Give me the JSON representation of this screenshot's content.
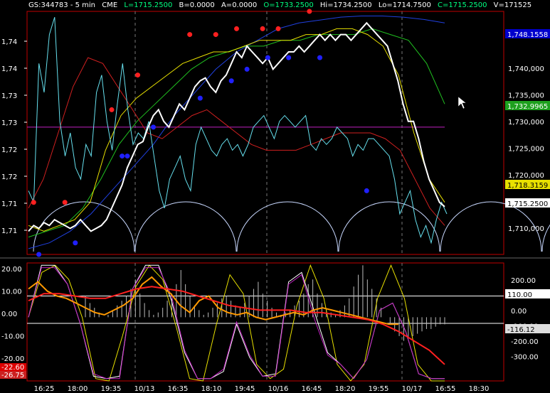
{
  "header": {
    "symbol": "GS:344783 - 5 min",
    "exchange": "CME",
    "last": "L=1715.2500",
    "bid": "B=0.0000",
    "ask": "A=0.0000",
    "open": "O=1733.2500",
    "high": "Hi=1734.2500",
    "low": "Lo=1714.7500",
    "close": "C=1715.2500",
    "volume": "V=171525"
  },
  "colors": {
    "background": "#000000",
    "frame": "#c00000",
    "price": "#ffffff",
    "cyan": "#66e0ee",
    "red_ma": "#d02020",
    "yellow_ma": "#e8e000",
    "green_ma": "#20c020",
    "blue_ma": "#2040e0",
    "magenta": "#c020c0",
    "arcs": "#c8d8ff",
    "dot_red": "#ff2020",
    "dot_blue": "#2020ff",
    "orange": "#ff9900"
  },
  "chart_data": [
    {
      "type": "line",
      "panel": "price",
      "y_ticks_left": [
        "1,74",
        "1,74",
        "1,73",
        "1,73",
        "1,72",
        "1,72",
        "1,71",
        "1,71"
      ],
      "y_ticks_right": [
        "1,740,000",
        "1,735,000",
        "1,730,000",
        "1,725,000",
        "1,720,000",
        "1,715,000",
        "1,710,000"
      ],
      "right_price_tags": [
        {
          "value": "1,748.1558",
          "color": "#0000cc"
        },
        {
          "value": "1,732.9965",
          "color": "#1ea01e"
        },
        {
          "value": "1,718.3159",
          "color": "#e8e000"
        },
        {
          "value": "1,715.2500",
          "color": "#ffffff"
        }
      ],
      "ylim": [
        1707,
        1749
      ],
      "horizontal_line": 1729,
      "price_series": [
        1711,
        1712,
        1711.5,
        1712.5,
        1712,
        1713,
        1712.5,
        1712,
        1711.5,
        1712,
        1713,
        1712,
        1711,
        1711.5,
        1712,
        1713,
        1715,
        1717,
        1719,
        1722,
        1724,
        1726,
        1726.5,
        1729,
        1731,
        1732,
        1730,
        1729,
        1731,
        1733,
        1732,
        1734,
        1736,
        1737,
        1737.5,
        1736,
        1735,
        1737,
        1738,
        1740,
        1742,
        1741,
        1743,
        1742,
        1741,
        1740,
        1741,
        1739,
        1740,
        1741,
        1742,
        1742,
        1743,
        1742,
        1743,
        1744,
        1745,
        1744,
        1745,
        1744,
        1745,
        1745,
        1744,
        1745,
        1746,
        1747,
        1746,
        1745,
        1744,
        1743,
        1740,
        1737,
        1733,
        1730,
        1730,
        1727,
        1723,
        1720,
        1718,
        1716,
        1715.25
      ],
      "cyan_series": [
        1718,
        1716,
        1740,
        1735,
        1745,
        1748,
        1730,
        1724,
        1728,
        1722,
        1720,
        1726,
        1724,
        1735,
        1738,
        1730,
        1725,
        1733,
        1740,
        1732,
        1726,
        1728,
        1727,
        1730,
        1724,
        1718,
        1715,
        1720,
        1722,
        1724,
        1720,
        1718,
        1726,
        1729,
        1727,
        1725,
        1724,
        1726,
        1727,
        1725,
        1726,
        1724,
        1726,
        1729,
        1730,
        1731,
        1729,
        1727,
        1730,
        1731,
        1730,
        1729,
        1730,
        1731,
        1726,
        1725,
        1727,
        1726,
        1727,
        1729,
        1728,
        1727,
        1724,
        1726,
        1725,
        1727,
        1727,
        1726,
        1725,
        1724,
        1720,
        1714,
        1716,
        1718,
        1713,
        1710,
        1712,
        1709,
        1713,
        1716,
        1714
      ],
      "red_ma": [
        1715,
        1720,
        1728,
        1736,
        1741,
        1740,
        1736,
        1732,
        1728,
        1727,
        1729,
        1731,
        1732,
        1730,
        1728,
        1726,
        1725,
        1725,
        1725,
        1726,
        1727,
        1728,
        1728,
        1728,
        1727,
        1725,
        1720,
        1715,
        1712
      ],
      "yellow_ma": [
        1712,
        1711,
        1712,
        1713,
        1716,
        1725,
        1731,
        1734,
        1736,
        1738,
        1740,
        1741,
        1742,
        1742,
        1743,
        1744,
        1744,
        1744,
        1745,
        1745,
        1746,
        1746,
        1745,
        1743,
        1738,
        1728,
        1720,
        1716
      ],
      "green_ma": [
        1710,
        1711,
        1712,
        1715,
        1720,
        1726,
        1730,
        1733,
        1736,
        1739,
        1741,
        1742,
        1743,
        1743,
        1744,
        1744,
        1745,
        1745,
        1745,
        1746,
        1745,
        1744,
        1740,
        1733
      ],
      "blue_ma": [
        1708,
        1709,
        1711,
        1714,
        1718,
        1722,
        1726,
        1731,
        1735,
        1739,
        1742,
        1744,
        1746,
        1747,
        1747.5,
        1748,
        1748.2,
        1748.2,
        1748,
        1747.6,
        1747
      ],
      "red_dots": [
        [
          1,
          1716
        ],
        [
          7,
          1716
        ],
        [
          16,
          1732
        ],
        [
          21,
          1738
        ],
        [
          31,
          1745
        ],
        [
          36,
          1745
        ],
        [
          40,
          1746
        ],
        [
          45,
          1746
        ],
        [
          48,
          1746
        ],
        [
          54,
          1749
        ]
      ],
      "blue_dots": [
        [
          2,
          1707
        ],
        [
          9,
          1709
        ],
        [
          18,
          1724
        ],
        [
          19,
          1724
        ],
        [
          24,
          1729
        ],
        [
          33,
          1734
        ],
        [
          39,
          1737
        ],
        [
          42,
          1739
        ],
        [
          46,
          1741
        ],
        [
          50,
          1741
        ],
        [
          56,
          1741
        ],
        [
          65,
          1718
        ]
      ]
    },
    {
      "type": "line",
      "panel": "oscillator",
      "y_ticks_left": [
        "20.00",
        "10.00",
        "0.00",
        "-10.00",
        "-20.00"
      ],
      "y_ticks_right": [
        "200.00",
        "100.00",
        "0.00",
        "-100.00",
        "-200.00",
        "-300.00"
      ],
      "left_tags": [
        {
          "value": "-22.60",
          "color": "#dd0000"
        },
        {
          "value": "-26.75",
          "color": "#cc2020"
        }
      ],
      "right_tags": [
        {
          "value": "110.00",
          "color": "#ffffff"
        },
        {
          "value": "-116.12",
          "color": "#dddddd"
        }
      ],
      "ylim": [
        -27,
        23
      ],
      "levels": [
        9,
        -2.6
      ],
      "yellow_osc": [
        0,
        19,
        22,
        16,
        0,
        -26,
        -27,
        -8,
        13,
        22,
        16,
        -4,
        -26,
        -27,
        -3,
        18,
        10,
        -20,
        -26,
        -22,
        5,
        22,
        8,
        -20,
        -27,
        -20,
        8,
        22,
        8,
        -20,
        -27,
        -27
      ],
      "magenta_osc": [
        0,
        21,
        21,
        14,
        -3,
        -24,
        -26,
        -26,
        12,
        21,
        21,
        9,
        -14,
        -26,
        -26,
        -22,
        -2,
        -16,
        -25,
        -25,
        14,
        18,
        -1,
        -16,
        -20,
        -26,
        -18,
        3,
        6,
        -6,
        -24,
        -26,
        -26
      ],
      "white_osc": [
        0,
        22,
        22,
        14,
        -3,
        -25,
        -26,
        -25,
        12,
        22,
        22,
        7,
        -15,
        -26,
        -26,
        -23,
        -3,
        -17,
        -25,
        -24,
        15,
        19,
        2,
        -15,
        -20,
        -26,
        -18,
        3,
        6,
        -6,
        -24,
        -26,
        -26
      ],
      "orange_line": [
        12,
        15,
        11,
        9,
        8,
        6,
        4,
        2,
        1,
        3,
        5,
        8,
        14,
        17,
        13,
        10,
        5,
        2,
        7,
        9,
        4,
        2,
        1,
        2,
        0,
        -1,
        0,
        1,
        2,
        1,
        3,
        4,
        3,
        2,
        1,
        0,
        -1,
        -2,
        -3,
        -3
      ],
      "red_line": [
        7,
        10,
        10,
        9,
        8,
        8,
        10,
        12,
        13,
        12,
        11,
        9,
        7,
        5,
        4,
        3,
        3,
        3,
        2,
        2,
        1,
        0,
        -1,
        -3,
        -6,
        -10,
        -14,
        -20
      ],
      "histogram": [
        9,
        6,
        4,
        2,
        0,
        1,
        3,
        5,
        7,
        9,
        12,
        16,
        10,
        6,
        3,
        1,
        2,
        4,
        7,
        10,
        14,
        20,
        14,
        9,
        5,
        3,
        1,
        2,
        4,
        6,
        8,
        9,
        7,
        5,
        4,
        6,
        9,
        12,
        15,
        10,
        7,
        4,
        2,
        1,
        2,
        3,
        5,
        7,
        10,
        14,
        16,
        10,
        6,
        3,
        2,
        1,
        3,
        5,
        8,
        13,
        18,
        22,
        16,
        12,
        8,
        4,
        0,
        -3,
        -6,
        -8,
        -10,
        -9,
        -8,
        -7,
        -6,
        -5,
        -5,
        -4,
        -3,
        -3
      ]
    }
  ],
  "x_axis_labels": [
    "16:25",
    "18:00",
    "19:35",
    "10/13",
    "16:35",
    "18:10",
    "19:45",
    "10/16",
    "16:45",
    "18:20",
    "19:55",
    "10/17",
    "16:55",
    "18:30"
  ],
  "x_axis_separators": [
    "10/13",
    "10/16",
    "10/17"
  ]
}
